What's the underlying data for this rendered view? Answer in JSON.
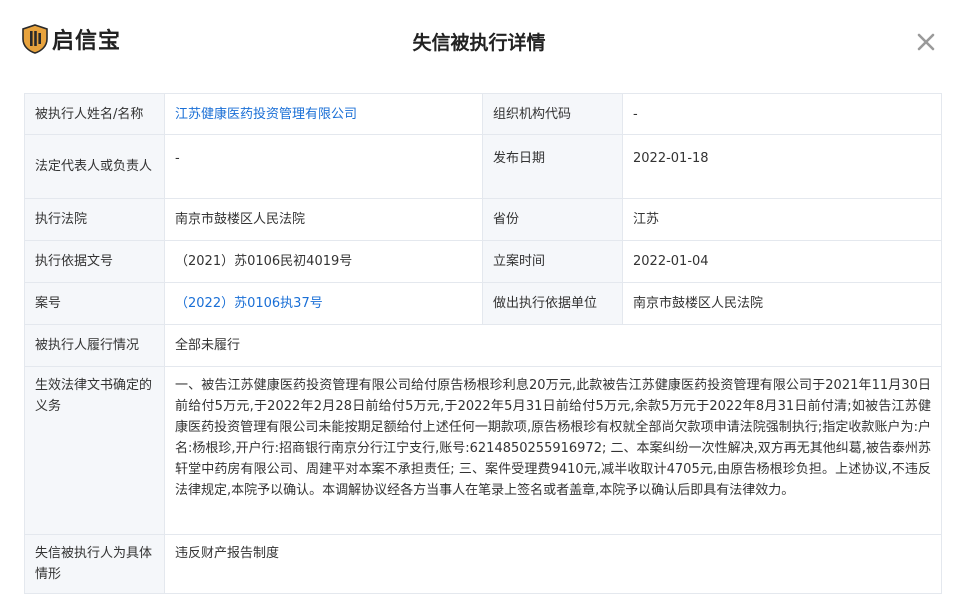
{
  "header": {
    "logo_text": "启信宝",
    "title": "失信被执行详情",
    "close_icon": "close-icon"
  },
  "colors": {
    "logo_shield": "#e8a33d",
    "link": "#1a6fd6",
    "label_bg": "#f5f7fa",
    "border": "#e4e8ee"
  },
  "rows": {
    "executee_name": {
      "label": "被执行人姓名/名称",
      "value": "江苏健康医药投资管理有限公司"
    },
    "org_code": {
      "label": "组织机构代码",
      "value": "-"
    },
    "legal_rep": {
      "label": "法定代表人或负责人",
      "value": "-"
    },
    "publish_date": {
      "label": "发布日期",
      "value": "2022-01-18"
    },
    "court": {
      "label": "执行法院",
      "value": "南京市鼓楼区人民法院"
    },
    "province": {
      "label": "省份",
      "value": "江苏"
    },
    "basis_doc_no": {
      "label": "执行依据文号",
      "value": "（2021）苏0106民初4019号"
    },
    "filing_date": {
      "label": "立案时间",
      "value": "2022-01-04"
    },
    "case_no": {
      "label": "案号",
      "value": "（2022）苏0106执37号"
    },
    "basis_unit": {
      "label": "做出执行依据单位",
      "value": "南京市鼓楼区人民法院"
    },
    "performance": {
      "label": "被执行人履行情况",
      "value": "全部未履行"
    },
    "duty": {
      "label": "生效法律文书确定的义务",
      "value": "一、被告江苏健康医药投资管理有限公司给付原告杨根珍利息20万元,此款被告江苏健康医药投资管理有限公司于2021年11月30日前给付5万元,于2022年2月28日前给付5万元,于2022年5月31日前给付5万元,余款5万元于2022年8月31日前付清;如被告江苏健康医药投资管理有限公司未能按期足额给付上述任何一期款项,原告杨根珍有权就全部尚欠款项申请法院强制执行;指定收款账户为:户名:杨根珍,开户行:招商银行南京分行江宁支行,账号:6214850255916972; 二、本案纠纷一次性解决,双方再无其他纠葛,被告泰州苏轩堂中药房有限公司、周建平对本案不承担责任; 三、案件受理费9410元,减半收取计4705元,由原告杨根珍负担。上述协议,不违反法律规定,本院予以确认。本调解协议经各方当事人在笔录上签名或者盖章,本院予以确认后即具有法律效力。"
    },
    "circumstance": {
      "label": "失信被执行人为具体情形",
      "value": "违反财产报告制度"
    }
  }
}
